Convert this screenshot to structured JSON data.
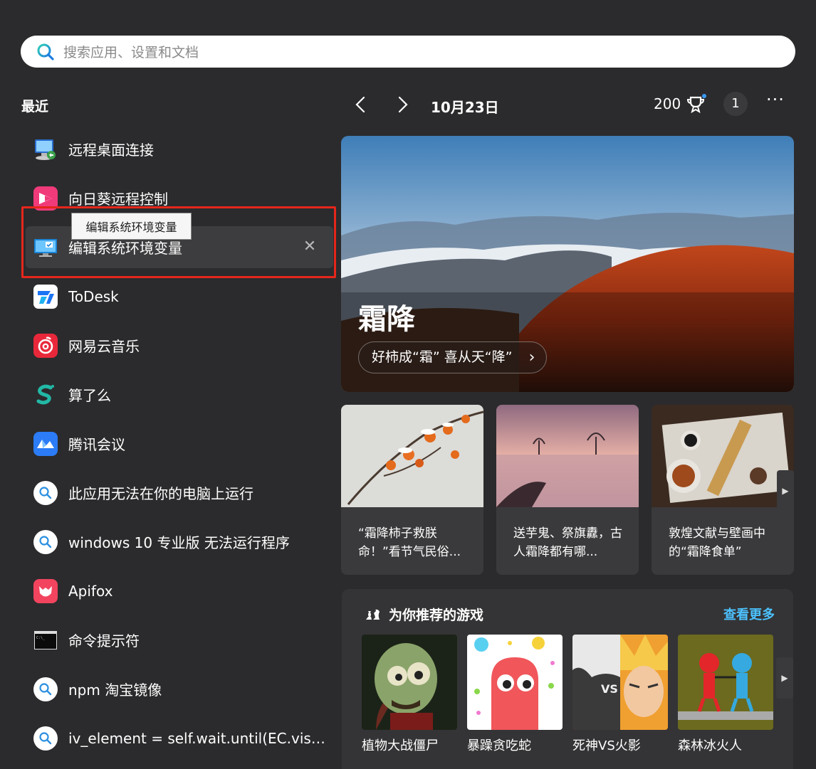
{
  "search": {
    "placeholder": "搜索应用、设置和文档"
  },
  "recent": {
    "title": "最近",
    "items": [
      {
        "label": "远程桌面连接",
        "icon": "remote-desktop-icon"
      },
      {
        "label": "向日葵远程控制",
        "icon": "sunlogin-icon"
      },
      {
        "label": "编辑系统环境变量",
        "icon": "system-properties-icon",
        "hover": true
      },
      {
        "label": "ToDesk",
        "icon": "todesk-icon"
      },
      {
        "label": "网易云音乐",
        "icon": "netease-music-icon"
      },
      {
        "label": "算了么",
        "icon": "suanleme-icon"
      },
      {
        "label": "腾讯会议",
        "icon": "tencent-meeting-icon"
      },
      {
        "label": "此应用无法在你的电脑上运行",
        "icon": "search-icon"
      },
      {
        "label": "windows 10 专业版 无法运行程序",
        "icon": "search-icon"
      },
      {
        "label": "Apifox",
        "icon": "apifox-icon"
      },
      {
        "label": "命令提示符",
        "icon": "cmd-icon"
      },
      {
        "label": "npm 淘宝镜像",
        "icon": "search-icon"
      },
      {
        "label": "iv_element = self.wait.until(EC.visibility_of_element_located",
        "icon": "search-icon"
      }
    ],
    "tooltip": "编辑系统环境变量"
  },
  "header": {
    "date": "10月23日",
    "points": "200",
    "notification_count": "1",
    "more": "···"
  },
  "hero": {
    "title": "霜降",
    "subtitle": "好柿成“霜” 喜从天“降”",
    "chevron": "›"
  },
  "cards": [
    {
      "text": "“霜降柿子救朕命！”看节气民俗..."
    },
    {
      "text": "送芋鬼、祭旗纛，古人霜降都有哪..."
    },
    {
      "text": "敦煌文献与壁画中的“霜降食单”"
    }
  ],
  "games": {
    "title": "为你推荐的游戏",
    "more_label": "查看更多",
    "items": [
      {
        "name": "植物大战僵尸"
      },
      {
        "name": "暴躁贪吃蛇"
      },
      {
        "name": "死神VS火影"
      },
      {
        "name": "森林冰火人"
      }
    ]
  },
  "colors": {
    "background": "#2b2b2d",
    "accent": "#4cc2ff",
    "highlight": "#e5261b"
  }
}
